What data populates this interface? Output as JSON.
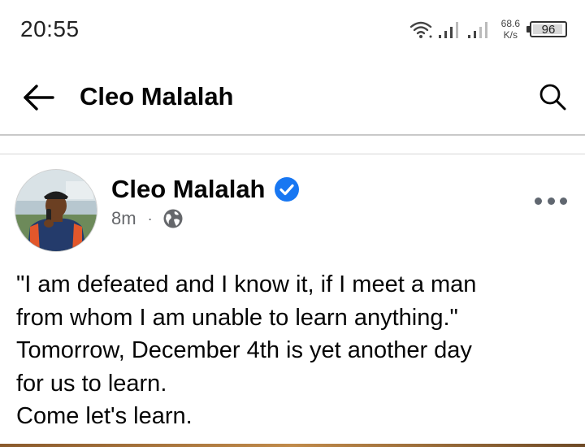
{
  "status_bar": {
    "time": "20:55",
    "net_speed_value": "68.6",
    "net_speed_unit": "K/s",
    "battery": "96",
    "battery_level": 0.96,
    "icons": [
      "wifi-icon",
      "signal-icon",
      "signal-icon",
      "battery-icon"
    ]
  },
  "header": {
    "title": "Cleo Malalah",
    "back_icon": "arrow-left-icon",
    "search_icon": "search-icon"
  },
  "post": {
    "author": "Cleo Malalah",
    "verified": true,
    "time_ago": "8m",
    "separator": "·",
    "audience_icon": "globe-icon",
    "more_icon": "more-horizontal-icon",
    "text_lines": [
      "\"I am defeated and I know it, if I meet a man",
      "from whom I am unable to learn anything.\"",
      "Tomorrow, December 4th is yet another day",
      "for us to learn.",
      "Come let's learn."
    ]
  },
  "colors": {
    "verified_blue": "#1877f2",
    "meta_gray": "#65676b",
    "text": "#050505"
  }
}
